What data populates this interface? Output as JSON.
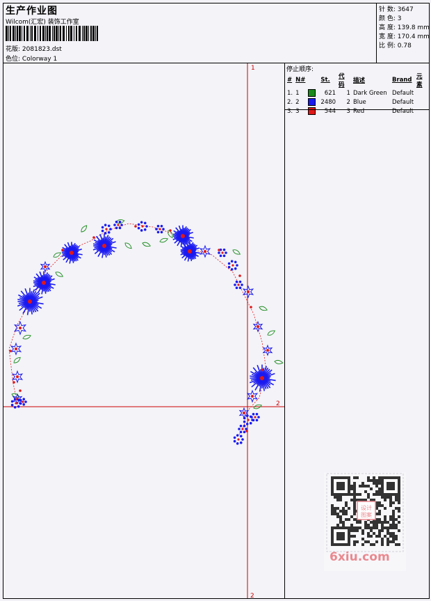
{
  "header": {
    "title": "生产作业图",
    "company": "Wilcom(汇宏) 装饰工作室",
    "file_label": "花版:",
    "file_value": "2081823.dst",
    "colorway_label": "色位:",
    "colorway_value": "Colorway 1"
  },
  "stats": [
    {
      "label": "针 数:",
      "value": "3647"
    },
    {
      "label": "颜 色:",
      "value": "3"
    },
    {
      "label": "高 度:",
      "value": "139.8 mm"
    },
    {
      "label": "宽 度:",
      "value": "170.4 mm"
    },
    {
      "label": "比 例:",
      "value": "0.78"
    }
  ],
  "stop_sequence": {
    "title": "停止顺序:",
    "columns": [
      "#",
      "N#",
      "St.",
      "代码",
      "描述",
      "Brand",
      "元素"
    ],
    "rows": [
      {
        "idx": "1.",
        "n": "1",
        "color": "#1a8a1a",
        "stitches": "621",
        "code": "1",
        "desc": "Dark Green",
        "brand": "Default"
      },
      {
        "idx": "2.",
        "n": "2",
        "color": "#1a1af0",
        "stitches": "2480",
        "code": "2",
        "desc": "Blue",
        "brand": "Default"
      },
      {
        "idx": "3.",
        "n": "3",
        "color": "#e01818",
        "stitches": "544",
        "code": "3",
        "desc": "Red",
        "brand": "Default"
      }
    ]
  },
  "guides": {
    "marker_top": "1",
    "marker_right": "2",
    "marker_bottom": "2",
    "color": "#cc0000"
  },
  "palette": {
    "green": "#1a8a1a",
    "blue": "#1a1af0",
    "red": "#e01818"
  },
  "watermark": {
    "text": "6xiu.com",
    "qr_badge": "设计 图案",
    "color": "#e9898f"
  }
}
